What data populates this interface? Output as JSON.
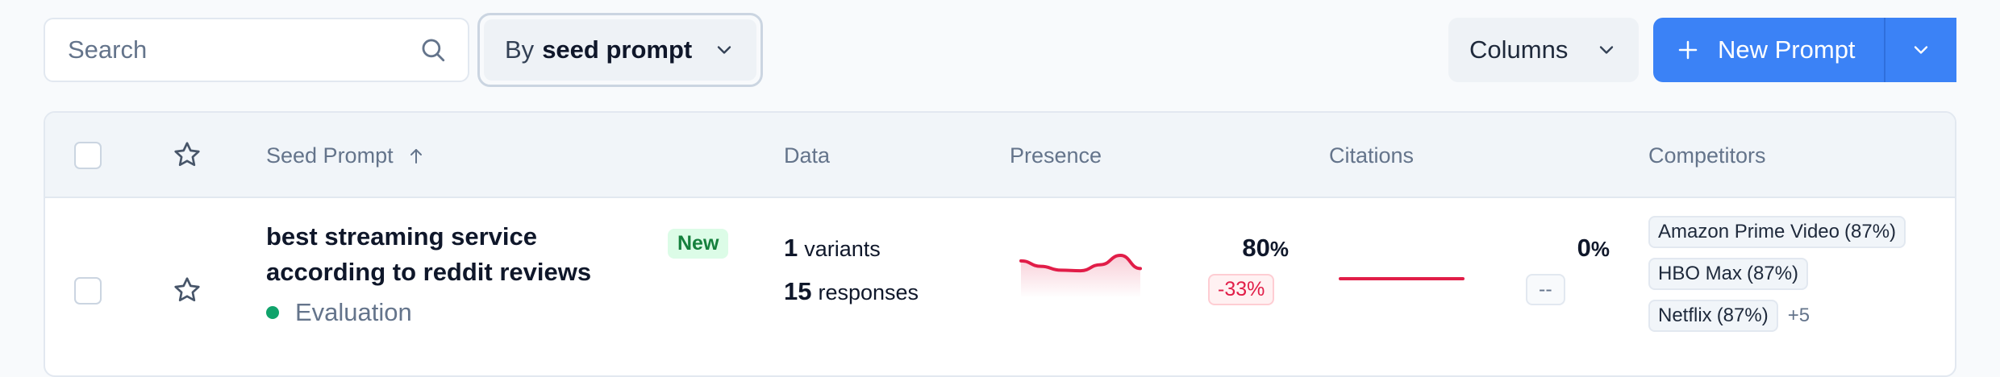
{
  "toolbar": {
    "search_placeholder": "Search",
    "group_by_prefix": "By",
    "group_by_value": "seed prompt",
    "columns_label": "Columns",
    "new_prompt_label": "New Prompt"
  },
  "table": {
    "headers": {
      "seed_prompt": "Seed Prompt",
      "data": "Data",
      "presence": "Presence",
      "citations": "Citations",
      "competitors": "Competitors"
    },
    "sort": {
      "column": "Seed Prompt",
      "direction": "ascending"
    },
    "rows": [
      {
        "title_line1": "best streaming service",
        "title_line2": "according to reddit reviews",
        "badge": "New",
        "status": "Evaluation",
        "variants_count": "1",
        "variants_label": "variants",
        "responses_count": "15",
        "responses_label": "responses",
        "presence": {
          "value": "80",
          "unit": "%",
          "delta": "-33%",
          "trend": [
            0.62,
            0.52,
            0.45,
            0.44,
            0.55,
            0.72,
            0.48
          ]
        },
        "citations": {
          "value": "0",
          "unit": "%",
          "delta": "--",
          "trend": [
            0,
            0,
            0,
            0,
            0,
            0,
            0
          ]
        },
        "competitors": [
          {
            "name": "Amazon Prime Video",
            "pct": "(87%)"
          },
          {
            "name": "HBO Max",
            "pct": "(87%)"
          },
          {
            "name": "Netflix",
            "pct": "(87%)"
          }
        ],
        "competitors_more": "+5"
      }
    ]
  },
  "colors": {
    "primary": "#3b82f6",
    "status_evaluation": "#10a36b",
    "negative": "#e11d48",
    "new_badge_bg": "#dcfce7",
    "new_badge_text": "#15803d"
  }
}
